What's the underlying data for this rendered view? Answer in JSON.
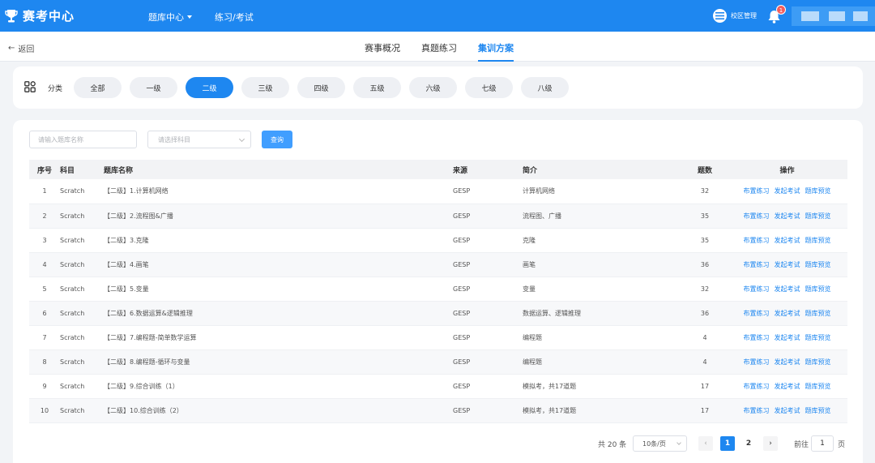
{
  "header": {
    "app_title": "赛考中心",
    "nav": [
      {
        "label": "题库中心",
        "has_dropdown": true
      },
      {
        "label": "练习/考试",
        "has_dropdown": false
      }
    ],
    "campus_label": "校区管理",
    "notification_count": "1",
    "brand_color": "#1e87f0"
  },
  "subheader": {
    "back_label": "返回",
    "tabs": [
      {
        "label": "赛事概况",
        "active": false
      },
      {
        "label": "真题练习",
        "active": false
      },
      {
        "label": "集训方案",
        "active": true
      }
    ]
  },
  "category": {
    "label": "分类",
    "pills": [
      {
        "label": "全部",
        "active": false
      },
      {
        "label": "一级",
        "active": false
      },
      {
        "label": "二级",
        "active": true
      },
      {
        "label": "三级",
        "active": false
      },
      {
        "label": "四级",
        "active": false
      },
      {
        "label": "五级",
        "active": false
      },
      {
        "label": "六级",
        "active": false
      },
      {
        "label": "七级",
        "active": false
      },
      {
        "label": "八级",
        "active": false
      }
    ]
  },
  "filters": {
    "name_placeholder": "请输入题库名称",
    "subject_placeholder": "请选择科目",
    "query_label": "查询"
  },
  "table": {
    "headers": [
      "序号",
      "科目",
      "题库名称",
      "来源",
      "简介",
      "题数",
      "操作"
    ],
    "action_labels": [
      "布置练习",
      "发起考试",
      "题库预览"
    ],
    "rows": [
      {
        "no": "1",
        "subject": "Scratch",
        "name": "【二级】1.计算机网络",
        "source": "GESP",
        "intro": "计算机网络",
        "count": "32"
      },
      {
        "no": "2",
        "subject": "Scratch",
        "name": "【二级】2.流程图&广播",
        "source": "GESP",
        "intro": "流程图、广播",
        "count": "35"
      },
      {
        "no": "3",
        "subject": "Scratch",
        "name": "【二级】3.克隆",
        "source": "GESP",
        "intro": "克隆",
        "count": "35"
      },
      {
        "no": "4",
        "subject": "Scratch",
        "name": "【二级】4.画笔",
        "source": "GESP",
        "intro": "画笔",
        "count": "36"
      },
      {
        "no": "5",
        "subject": "Scratch",
        "name": "【二级】5.变量",
        "source": "GESP",
        "intro": "变量",
        "count": "32"
      },
      {
        "no": "6",
        "subject": "Scratch",
        "name": "【二级】6.数据运算&逻辑推理",
        "source": "GESP",
        "intro": "数据运算、逻辑推理",
        "count": "36"
      },
      {
        "no": "7",
        "subject": "Scratch",
        "name": "【二级】7.编程题-简单数学运算",
        "source": "GESP",
        "intro": "编程题",
        "count": "4"
      },
      {
        "no": "8",
        "subject": "Scratch",
        "name": "【二级】8.编程题-循环与变量",
        "source": "GESP",
        "intro": "编程题",
        "count": "4"
      },
      {
        "no": "9",
        "subject": "Scratch",
        "name": "【二级】9.综合训练（1）",
        "source": "GESP",
        "intro": "模拟考，共17道题",
        "count": "17"
      },
      {
        "no": "10",
        "subject": "Scratch",
        "name": "【二级】10.综合训练（2）",
        "source": "GESP",
        "intro": "模拟考，共17道题",
        "count": "17"
      }
    ]
  },
  "pagination": {
    "total_label": "共 20 条",
    "page_size": "10条/页",
    "pages": [
      "1",
      "2"
    ],
    "current_page": "1",
    "goto_label": "前往",
    "goto_value": "1",
    "goto_unit": "页"
  }
}
